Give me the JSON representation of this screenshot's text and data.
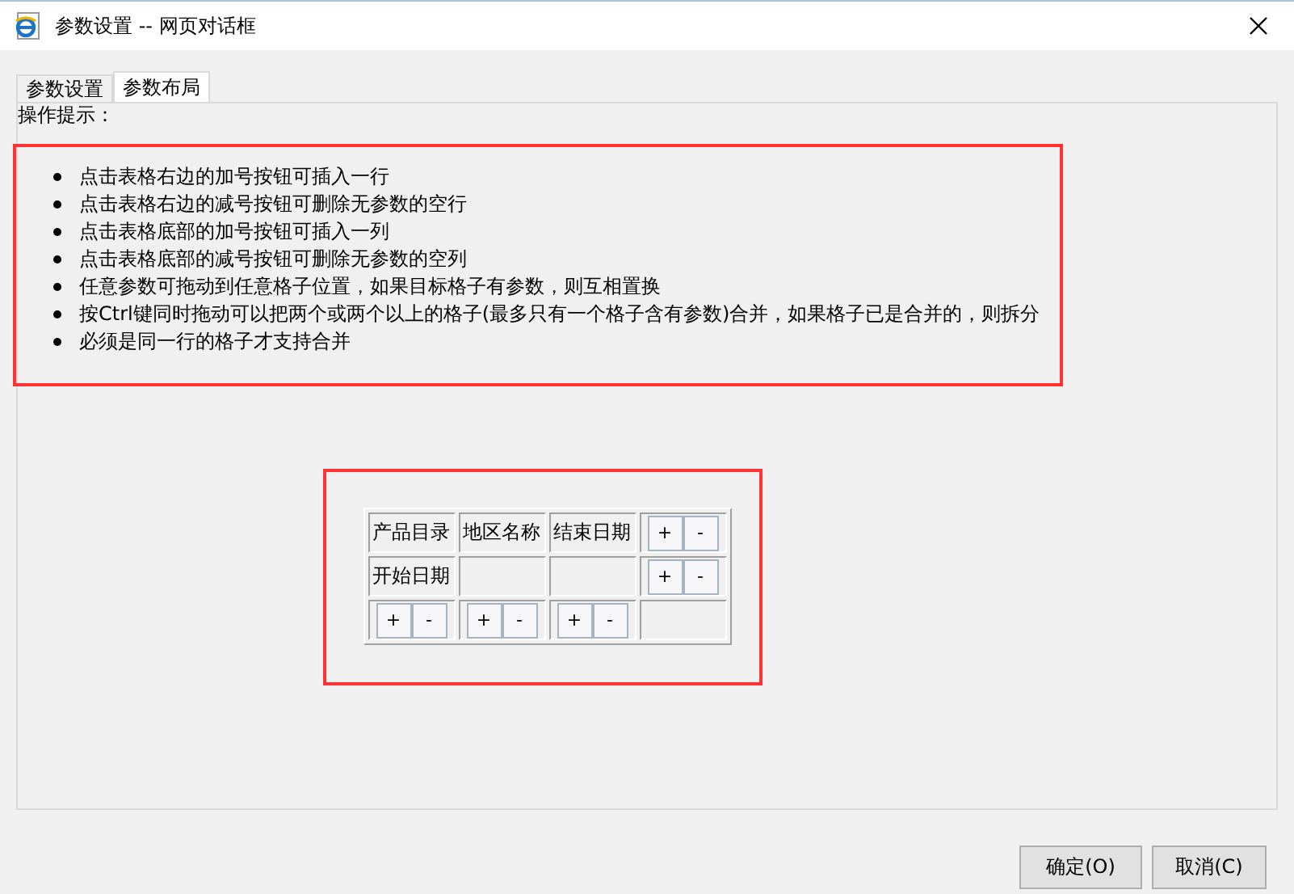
{
  "window": {
    "title": "参数设置 -- 网页对话框"
  },
  "tabs": [
    {
      "label": "参数设置",
      "selected": false
    },
    {
      "label": "参数布局",
      "selected": true
    }
  ],
  "hint_title": "操作提示：",
  "hints": [
    "点击表格右边的加号按钮可插入一行",
    "点击表格右边的减号按钮可删除无参数的空行",
    "点击表格底部的加号按钮可插入一列",
    "点击表格底部的减号按钮可删除无参数的空列",
    "任意参数可拖动到任意格子位置，如果目标格子有参数，则互相置换",
    "按Ctrl键同时拖动可以把两个或两个以上的格子(最多只有一个格子含有参数)合并，如果格子已是合并的，则拆分",
    "必须是同一行的格子才支持合并"
  ],
  "grid": {
    "rows": [
      {
        "cells": [
          {
            "kind": "text",
            "text": "产品目录"
          },
          {
            "kind": "text",
            "text": "地区名称"
          },
          {
            "kind": "text",
            "text": "结束日期"
          },
          {
            "kind": "buttons",
            "buttons": [
              "+",
              "-"
            ]
          }
        ]
      },
      {
        "cells": [
          {
            "kind": "text",
            "text": "开始日期"
          },
          {
            "kind": "empty"
          },
          {
            "kind": "empty"
          },
          {
            "kind": "buttons",
            "buttons": [
              "+",
              "-"
            ]
          }
        ]
      },
      {
        "cells": [
          {
            "kind": "buttons",
            "buttons": [
              "+",
              "-"
            ]
          },
          {
            "kind": "buttons",
            "buttons": [
              "+",
              "-"
            ]
          },
          {
            "kind": "buttons",
            "buttons": [
              "+",
              "-"
            ]
          },
          {
            "kind": "empty"
          }
        ]
      }
    ]
  },
  "buttons": [
    "确定(O)",
    "取消(C)"
  ]
}
